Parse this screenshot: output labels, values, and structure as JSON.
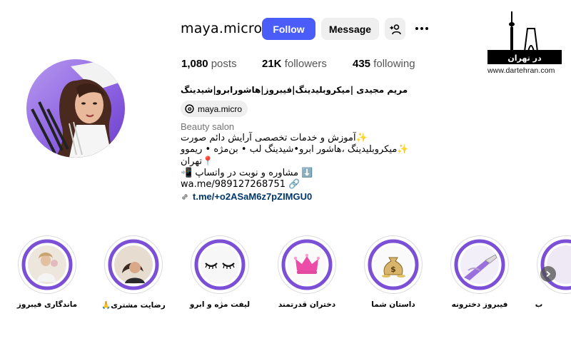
{
  "profile": {
    "username": "maya.micro",
    "follow_label": "Follow",
    "message_label": "Message",
    "posts_count": "1,080",
    "posts_label": "posts",
    "followers_count": "21K",
    "followers_label": "followers",
    "following_count": "435",
    "following_label": "following",
    "full_name": "مریم مجیدی |میکروبلیدینگ|فیبروز|هاشورابرو|شیدینگ",
    "threads_handle": "maya.micro",
    "category": "Beauty salon",
    "bio_lines": [
      "✨آموزش و خدمات تخصصی آرایش دائم صورت",
      "✨میکروبلیدینگ ،هاشور ابرو•شیدینگ لب • بن‌مژه • ریموو",
      "📍تهران",
      "⬇️ مشاوره و نوبت در واتساپ 📲",
      "wa.me/989127268751 🔗"
    ],
    "link": "t.me/+o2ASaM6z7pZIMGU0"
  },
  "highlights": [
    {
      "label": "ماندگاری فیبروز",
      "icon": "girl-photo"
    },
    {
      "label": "رضایت مشتری🙏",
      "icon": "client-photo"
    },
    {
      "label": "لیفت مژه و ابرو",
      "icon": "eyelash-icon"
    },
    {
      "label": "دختران قدرتمند",
      "icon": "crown-icon"
    },
    {
      "label": "داستان شما",
      "icon": "money-bag-icon"
    },
    {
      "label": "فیبروز دخترونه",
      "icon": "fibrous-tool-photo"
    },
    {
      "label": "ب",
      "icon": "partial-highlight"
    }
  ],
  "watermark": {
    "logo_text": "در تهران",
    "url": "www.dartehran.com"
  },
  "colors": {
    "follow_blue": "#4a5df9",
    "button_gray": "#efefef",
    "link_blue": "#00376b",
    "highlight_purple": "#7b4fd6"
  }
}
